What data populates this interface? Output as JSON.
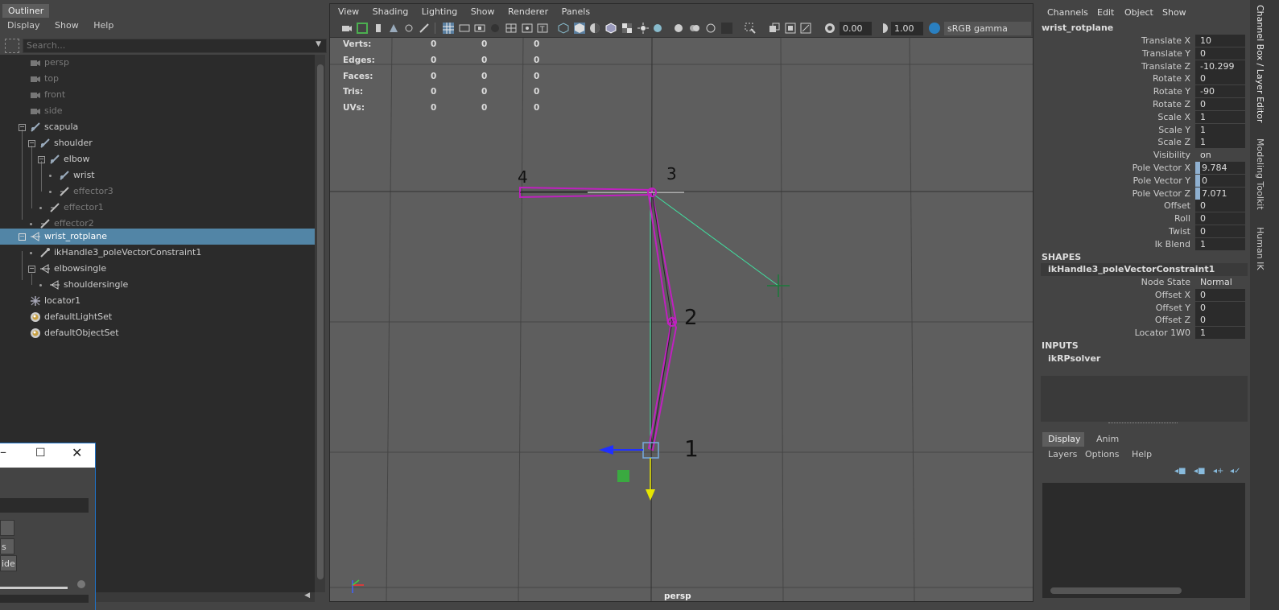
{
  "outliner": {
    "title": "Outliner",
    "menu": [
      "Display",
      "Show",
      "Help"
    ],
    "search_placeholder": "Search...",
    "items": [
      {
        "label": "persp",
        "dim": true
      },
      {
        "label": "top",
        "dim": true
      },
      {
        "label": "front",
        "dim": true
      },
      {
        "label": "side",
        "dim": true
      },
      {
        "label": "scapula"
      },
      {
        "label": "shoulder"
      },
      {
        "label": "elbow"
      },
      {
        "label": "wrist"
      },
      {
        "label": "effector3",
        "dim": true
      },
      {
        "label": "effector1",
        "dim": true
      },
      {
        "label": "effector2",
        "dim": true
      },
      {
        "label": "wrist_rotplane",
        "selected": true
      },
      {
        "label": "ikHandle3_poleVectorConstraint1"
      },
      {
        "label": "elbowsingle"
      },
      {
        "label": "shouldersingle"
      },
      {
        "label": "locator1"
      },
      {
        "label": "defaultLightSet"
      },
      {
        "label": "defaultObjectSet"
      }
    ]
  },
  "float_window": {
    "buttons": [
      "s",
      "ide"
    ]
  },
  "viewport": {
    "menu": [
      "View",
      "Shading",
      "Lighting",
      "Show",
      "Renderer",
      "Panels"
    ],
    "exposure": "0.00",
    "gamma": "1.00",
    "color_space": "sRGB gamma",
    "hud": [
      {
        "label": "Verts:",
        "a": "0",
        "b": "0",
        "c": "0"
      },
      {
        "label": "Edges:",
        "a": "0",
        "b": "0",
        "c": "0"
      },
      {
        "label": "Faces:",
        "a": "0",
        "b": "0",
        "c": "0"
      },
      {
        "label": "Tris:",
        "a": "0",
        "b": "0",
        "c": "0"
      },
      {
        "label": "UVs:",
        "a": "0",
        "b": "0",
        "c": "0"
      }
    ],
    "camera_label": "persp",
    "annotations": [
      "1",
      "2",
      "3",
      "4"
    ]
  },
  "channel_box": {
    "menu": [
      "Channels",
      "Edit",
      "Object",
      "Show"
    ],
    "node": "wrist_rotplane",
    "attrs": [
      {
        "name": "Translate X",
        "value": "10"
      },
      {
        "name": "Translate Y",
        "value": "0"
      },
      {
        "name": "Translate Z",
        "value": "-10.299"
      },
      {
        "name": "Rotate X",
        "value": "0"
      },
      {
        "name": "Rotate Y",
        "value": "-90"
      },
      {
        "name": "Rotate Z",
        "value": "0"
      },
      {
        "name": "Scale X",
        "value": "1"
      },
      {
        "name": "Scale Y",
        "value": "1"
      },
      {
        "name": "Scale Z",
        "value": "1"
      },
      {
        "name": "Visibility",
        "value": "on",
        "plain": true
      },
      {
        "name": "Pole Vector X",
        "value": "9.784",
        "hl": true
      },
      {
        "name": "Pole Vector Y",
        "value": "0",
        "hl": true
      },
      {
        "name": "Pole Vector Z",
        "value": "7.071",
        "hl": true
      },
      {
        "name": "Offset",
        "value": "0"
      },
      {
        "name": "Roll",
        "value": "0"
      },
      {
        "name": "Twist",
        "value": "0"
      },
      {
        "name": "Ik Blend",
        "value": "1"
      }
    ],
    "shapes_header": "SHAPES",
    "shape_node": "ikHandle3_poleVectorConstraint1",
    "shape_attrs": [
      {
        "name": "Node State",
        "value": "Normal",
        "plain": true
      },
      {
        "name": "Offset X",
        "value": "0"
      },
      {
        "name": "Offset Y",
        "value": "0"
      },
      {
        "name": "Offset Z",
        "value": "0"
      },
      {
        "name": "Locator 1W0",
        "value": "1"
      }
    ],
    "inputs_header": "INPUTS",
    "input_node": "ikRPsolver",
    "layer_tabs": [
      "Display",
      "Anim"
    ],
    "layer_menu": [
      "Layers",
      "Options",
      "Help"
    ]
  },
  "side_tabs": [
    "Channel Box / Layer Editor",
    "Modeling Toolkit",
    "Human IK"
  ]
}
